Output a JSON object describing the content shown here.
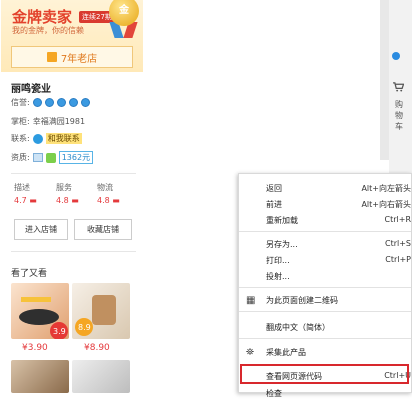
{
  "seller": {
    "gold_title": "金牌卖家",
    "gold_badge": "连续27期",
    "slogan": "我的金牌，你的信赖",
    "medal": "金",
    "years": "7年老店",
    "shop_name": "丽鸣瓷业",
    "credit_label": "信誉:",
    "credit_level_count": 5,
    "owner_label": "掌柜:",
    "owner_name": "幸福满园1981",
    "contact_label": "联系:",
    "contact_text": "和我联系",
    "qualification_label": "资质:",
    "deposit_amount": "1362元",
    "scores": [
      {
        "label": "描述",
        "value": "4.7"
      },
      {
        "label": "服务",
        "value": "4.8"
      },
      {
        "label": "物流",
        "value": "4.8"
      }
    ],
    "enter_shop": "进入店铺",
    "favorite_shop": "收藏店铺"
  },
  "recommendations": {
    "title": "看了又看",
    "items": [
      {
        "price": "¥3.90",
        "tag": "3.9"
      },
      {
        "price": "¥8.90",
        "tag": "8.9"
      }
    ]
  },
  "browser_edge": {
    "cart_label": "购物车"
  },
  "context_menu": {
    "items": [
      {
        "label": "返回",
        "shortcut": "Alt+向左箭头"
      },
      {
        "label": "前进",
        "shortcut": "Alt+向右箭头"
      },
      {
        "label": "重新加载",
        "shortcut": "Ctrl+R"
      },
      {
        "label": "另存为...",
        "shortcut": "Ctrl+S"
      },
      {
        "label": "打印...",
        "shortcut": "Ctrl+P"
      },
      {
        "label": "投射...",
        "shortcut": ""
      },
      {
        "label": "为此页面创建二维码",
        "shortcut": "",
        "icon": "qr-code-icon"
      },
      {
        "label": "翻成中文（简体）",
        "shortcut": ""
      },
      {
        "label": "采集此产品",
        "shortcut": "",
        "icon": "collect-icon"
      },
      {
        "label": "查看网页源代码",
        "shortcut": "Ctrl+U"
      },
      {
        "label": "检查",
        "shortcut": ""
      }
    ]
  },
  "colors": {
    "accent_red": "#e4393c",
    "gold_bg": "#ffe9b8",
    "highlight_border": "#d8282d"
  }
}
